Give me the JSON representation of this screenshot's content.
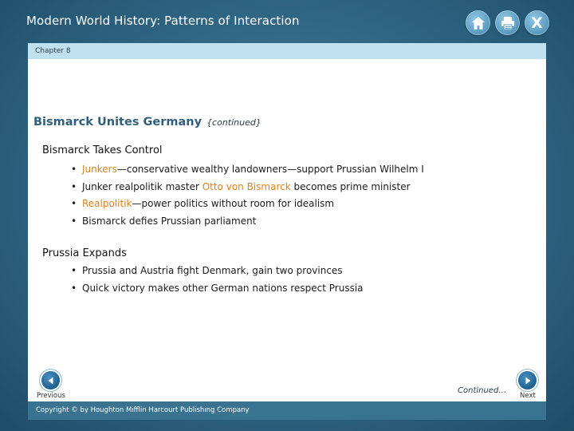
{
  "header": {
    "title": "Modern World History: Patterns of Interaction",
    "icons": [
      "home-icon",
      "print-icon",
      "close-icon"
    ],
    "close_glyph": "X"
  },
  "chapter": "Chapter 8",
  "slide": {
    "title": "Bismarck Unites Germany",
    "title_suffix": "{continued}",
    "sections": [
      {
        "heading": "Bismarck Takes Control",
        "bullets": [
          {
            "parts": [
              {
                "text": "Junkers",
                "highlight": true
              },
              {
                "text": "—conservative wealthy landowners—support Prussian Wilhelm I",
                "highlight": false
              }
            ]
          },
          {
            "parts": [
              {
                "text": "Junker realpolitik master ",
                "highlight": false
              },
              {
                "text": "Otto von Bismarck",
                "highlight": true
              },
              {
                "text": " becomes prime minister",
                "highlight": false
              }
            ]
          },
          {
            "parts": [
              {
                "text": "Realpolitik",
                "highlight": true
              },
              {
                "text": "—power politics without room for idealism",
                "highlight": false
              }
            ]
          },
          {
            "parts": [
              {
                "text": "Bismarck defies Prussian parliament",
                "highlight": false
              }
            ]
          }
        ]
      },
      {
        "heading": "Prussia Expands",
        "bullets": [
          {
            "parts": [
              {
                "text": "Prussia and Austria fight Denmark, gain two provinces",
                "highlight": false
              }
            ]
          },
          {
            "parts": [
              {
                "text": "Quick victory makes other German nations respect Prussia",
                "highlight": false
              }
            ]
          }
        ]
      }
    ]
  },
  "nav": {
    "previous_label": "Previous",
    "next_label": "Next",
    "continued_label": "Continued…"
  },
  "footer": {
    "copyright": "Copyright © by Houghton Mifflin Harcourt Publishing Company"
  },
  "colors": {
    "highlight": "#d9821f",
    "title": "#2f5f7a",
    "chapter_bar": "#bfe1f0",
    "footer_bar": "#39738f"
  }
}
